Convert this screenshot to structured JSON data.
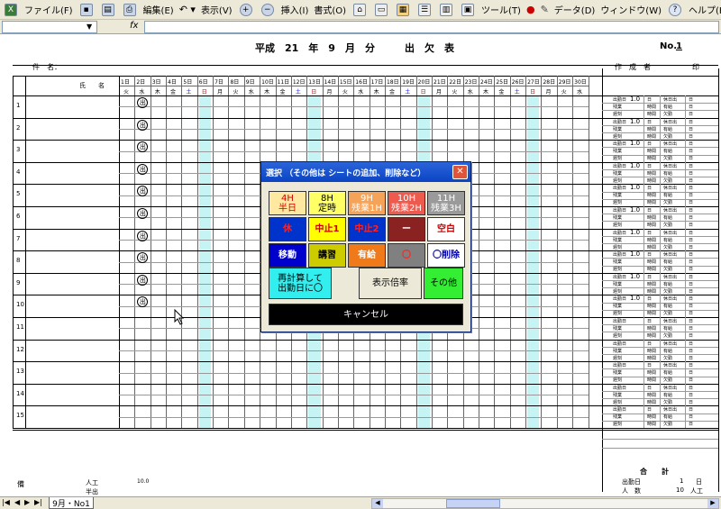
{
  "menu": {
    "file": "ファイル(F)",
    "edit": "編集(E)",
    "view": "表示(V)",
    "insert": "挿入(I)",
    "format": "書式(O)",
    "tools": "ツール(T)",
    "data": "データ(D)",
    "window": "ウィンドウ(W)",
    "help": "ヘルプ(H)"
  },
  "formula": {
    "fx": "fx"
  },
  "sheet": {
    "title": "平成　21　年　9　月　分　　　出　欠　表",
    "no_label": "No.",
    "no_value": "1",
    "kenmei_label": "件　名：",
    "sakuseisha_label": "作　成　者",
    "in_label": "印",
    "name_header": "氏　　名",
    "days": [
      "1日",
      "2日",
      "3日",
      "4日",
      "5日",
      "6日",
      "7日",
      "8日",
      "9日",
      "10日",
      "11日",
      "12日",
      "13日",
      "14日",
      "15日",
      "16日",
      "17日",
      "18日",
      "19日",
      "20日",
      "21日",
      "22日",
      "23日",
      "24日",
      "25日",
      "26日",
      "27日",
      "28日",
      "29日",
      "30日"
    ],
    "weekdays": [
      "火",
      "水",
      "木",
      "金",
      "土",
      "日",
      "月",
      "火",
      "水",
      "木",
      "金",
      "土",
      "日",
      "月",
      "火",
      "水",
      "木",
      "金",
      "土",
      "日",
      "月",
      "火",
      "水",
      "木",
      "金",
      "土",
      "日",
      "月",
      "火",
      "水"
    ],
    "row_numbers": [
      "1",
      "2",
      "3",
      "4",
      "5",
      "6",
      "7",
      "8",
      "9",
      "10",
      "11",
      "12",
      "13",
      "14",
      "15"
    ],
    "stamp": "出",
    "side_labels": {
      "workday": "出勤日",
      "value": "1.0",
      "unit_day": "日",
      "paid": "有給",
      "late": "遅刻",
      "absent": "欠勤",
      "overtime": "残業",
      "time": "時間",
      "holiday": "休日出",
      "h": "H"
    },
    "bottom": {
      "remarks": "備",
      "manpower": "人工",
      "half": "半出",
      "manpower_value": "10.0"
    },
    "totals": {
      "header": "合　　計",
      "workdays_label": "出勤日",
      "workdays_value": "1",
      "workdays_unit": "日",
      "manpower_label": "人　数",
      "manpower_value": "10",
      "manpower_unit": "人工"
    }
  },
  "dialog": {
    "title": "選択 （その他は シートの追加、削除など）",
    "close": "✕",
    "buttons": [
      {
        "line1": "4H",
        "line2": "半日",
        "bg": "#ffe8a0",
        "fg": "#cc0000"
      },
      {
        "line1": "8H",
        "line2": "定時",
        "bg": "#ffff66",
        "fg": "#000000"
      },
      {
        "line1": "9H",
        "line2": "残業1H",
        "bg": "#f6a35a",
        "fg": "#ffffff"
      },
      {
        "line1": "10H",
        "line2": "残業2H",
        "bg": "#ee5a4e",
        "fg": "#ffffff"
      },
      {
        "line1": "11H",
        "line2": "残業3H",
        "bg": "#9a9a9a",
        "fg": "#ffffff"
      },
      {
        "line1": "休",
        "line2": "",
        "bg": "#0033cc",
        "fg": "#ff2222"
      },
      {
        "line1": "中止1",
        "line2": "",
        "bg": "#ffff00",
        "fg": "#cc0000"
      },
      {
        "line1": "中止2",
        "line2": "",
        "bg": "#0033cc",
        "fg": "#ff2222"
      },
      {
        "line1": "ー",
        "line2": "",
        "bg": "#8b2222",
        "fg": "#ffffff"
      },
      {
        "line1": "空白",
        "line2": "",
        "bg": "#ffffff",
        "fg": "#cc0000"
      },
      {
        "line1": "移動",
        "line2": "",
        "bg": "#0000cc",
        "fg": "#ffffff"
      },
      {
        "line1": "講習",
        "line2": "",
        "bg": "#cccc00",
        "fg": "#000000"
      },
      {
        "line1": "有給",
        "line2": "",
        "bg": "#f07a1a",
        "fg": "#ffffff"
      },
      {
        "line1": "〇",
        "line2": "",
        "bg": "#808080",
        "fg": "#ff2222"
      },
      {
        "line1": "〇削除",
        "line2": "",
        "bg": "#ffffff",
        "fg": "#0000aa"
      }
    ],
    "recalc_line1": "再計算して",
    "recalc_line2": "出勤日に〇",
    "zoom": "表示倍率",
    "other": "その他",
    "cancel": "キャンセル"
  },
  "tabs": {
    "sheet_tab": "9月・No1"
  },
  "colors": {
    "weekend_col": "#c6f3f3",
    "sat": "#0000cc",
    "sun": "#cc0000"
  }
}
